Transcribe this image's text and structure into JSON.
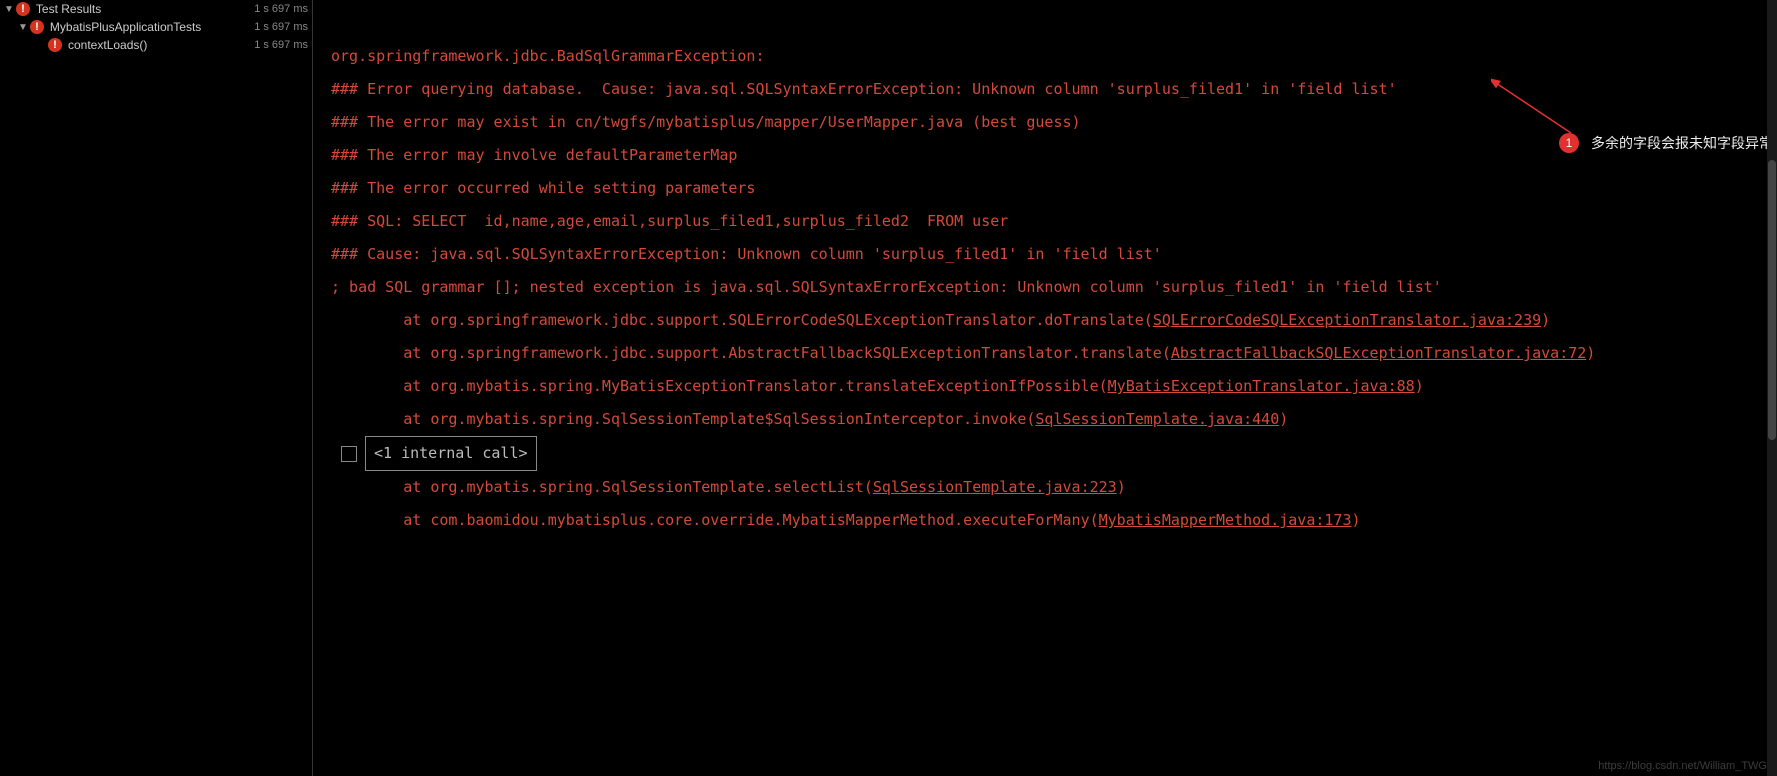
{
  "tree": {
    "root": {
      "label": "Test Results",
      "time": "1 s 697 ms"
    },
    "item1": {
      "label": "MybatisPlusApplicationTests",
      "time": "1 s 697 ms"
    },
    "item2": {
      "label": "contextLoads()",
      "time": "1 s 697 ms"
    }
  },
  "console": {
    "l1": "org.springframework.jdbc.BadSqlGrammarException: ",
    "l2": "### Error querying database.  Cause: java.sql.SQLSyntaxErrorException: Unknown column 'surplus_filed1' in 'field list'",
    "l3": "### The error may exist in cn/twgfs/mybatisplus/mapper/UserMapper.java (best guess)",
    "l4": "### The error may involve defaultParameterMap",
    "l5": "### The error occurred while setting parameters",
    "l6": "### SQL: SELECT  id,name,age,email,surplus_filed1,surplus_filed2  FROM user",
    "l7": "### Cause: java.sql.SQLSyntaxErrorException: Unknown column 'surplus_filed1' in 'field list'",
    "l8": "; bad SQL grammar []; nested exception is java.sql.SQLSyntaxErrorException: Unknown column 'surplus_filed1' in 'field list'",
    "l9": "",
    "l10a": "\tat org.springframework.jdbc.support.SQLErrorCodeSQLExceptionTranslator.doTranslate(",
    "l10link": "SQLErrorCodeSQLExceptionTranslator.java:239",
    "l10b": ")",
    "l11a": "\tat org.springframework.jdbc.support.AbstractFallbackSQLExceptionTranslator.translate(",
    "l11link": "AbstractFallbackSQLExceptionTranslator.java:72",
    "l11b": ")",
    "l12a": "\tat org.mybatis.spring.MyBatisExceptionTranslator.translateExceptionIfPossible(",
    "l12link": "MyBatisExceptionTranslator.java:88",
    "l12b": ")",
    "l13a": "\tat org.mybatis.spring.SqlSessionTemplate$SqlSessionInterceptor.invoke(",
    "l13link": "SqlSessionTemplate.java:440",
    "l13b": ")",
    "internal": "<1 internal call>",
    "l14a": "\tat org.mybatis.spring.SqlSessionTemplate.selectList(",
    "l14link": "SqlSessionTemplate.java:223",
    "l14b": ")",
    "l15a": "\tat com.baomidou.mybatisplus.core.override.MybatisMapperMethod.executeForMany(",
    "l15link": "MybatisMapperMethod.java:173",
    "l15b": ")"
  },
  "annotation": {
    "badge": "1",
    "text": "多余的字段会报未知字段异常"
  },
  "watermark": "https://blog.csdn.net/William_TWG",
  "expand_btn": "+"
}
